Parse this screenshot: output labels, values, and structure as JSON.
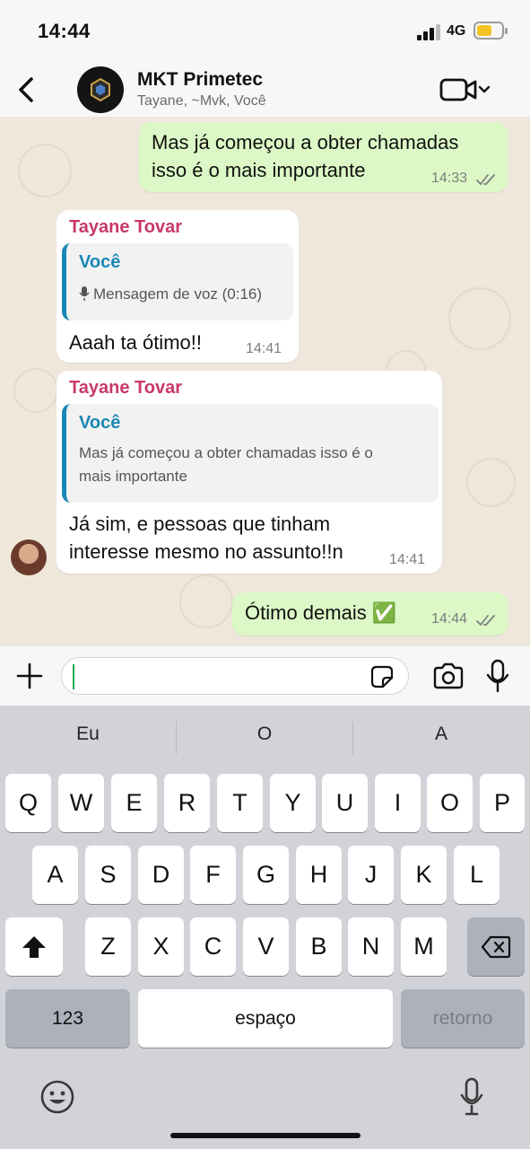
{
  "status_bar": {
    "time": "14:44",
    "network": "4G"
  },
  "header": {
    "title": "MKT Primetec",
    "subtitle": "Tayane, ~Mvk, Você"
  },
  "messages": [
    {
      "direction": "out",
      "text_line1": "Mas já começou a obter chamadas",
      "text_line2": "isso é o mais importante",
      "time": "14:33"
    },
    {
      "direction": "in",
      "sender": "Tayane Tovar",
      "quote_author": "Você",
      "quote_text": "Mensagem de voz (0:16)",
      "text": "Aaah ta ótimo!!",
      "time": "14:41"
    },
    {
      "direction": "in",
      "sender": "Tayane Tovar",
      "quote_author": "Você",
      "quote_line1": "Mas já começou a obter chamadas isso é o",
      "quote_line2": "mais importante",
      "text_line1": "Já sim, e pessoas que tinham",
      "text_line2": "interesse mesmo no assunto!!n",
      "time": "14:41"
    },
    {
      "direction": "out",
      "text": "Ótimo demais ✅",
      "time": "14:44"
    }
  ],
  "input": {
    "value": "",
    "placeholder": ""
  },
  "keyboard": {
    "suggestions": [
      "Eu",
      "O",
      "A"
    ],
    "row1": [
      "Q",
      "W",
      "E",
      "R",
      "T",
      "Y",
      "U",
      "I",
      "O",
      "P"
    ],
    "row2": [
      "A",
      "S",
      "D",
      "F",
      "G",
      "H",
      "J",
      "K",
      "L"
    ],
    "row3": [
      "Z",
      "X",
      "C",
      "V",
      "B",
      "N",
      "M"
    ],
    "numbers_label": "123",
    "space_label": "espaço",
    "return_label": "retorno"
  },
  "colors": {
    "outgoing_bubble": "#dcf8c6",
    "incoming_bubble": "#ffffff",
    "sender_name": "#c8386a",
    "quote_accent": "#1a87b6",
    "read_ticks": "#7d7d7d",
    "chat_background": "#efe7dc"
  },
  "icons": [
    "back-chevron-icon",
    "group-avatar",
    "video-call-icon",
    "chevron-down-icon",
    "double-check-icon",
    "mic-icon",
    "plus-icon",
    "sticker-icon",
    "camera-icon",
    "shift-icon",
    "backspace-icon",
    "emoji-icon",
    "dictation-mic-icon"
  ]
}
